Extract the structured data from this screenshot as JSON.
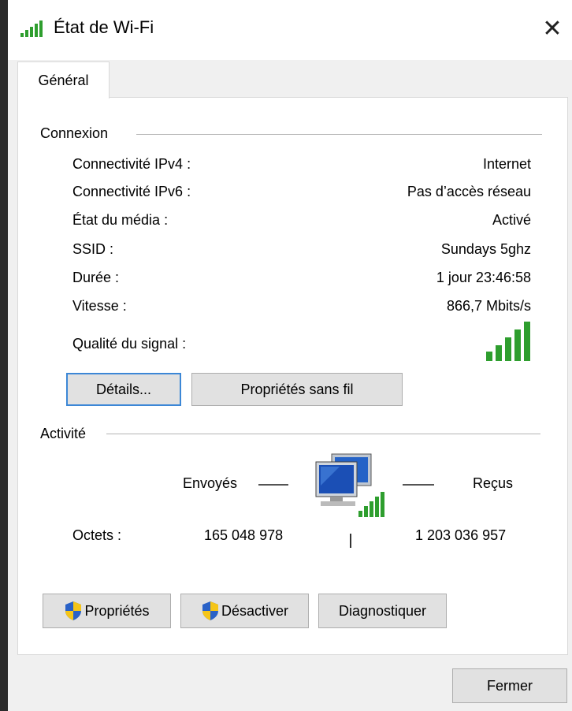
{
  "window": {
    "title": "État de Wi-Fi"
  },
  "tabs": [
    {
      "label": "Général"
    }
  ],
  "connexion": {
    "heading": "Connexion",
    "rows": [
      {
        "label": "Connectivité IPv4 :",
        "value": "Internet"
      },
      {
        "label": "Connectivité IPv6 :",
        "value": "Pas d’accès réseau"
      },
      {
        "label": "État du média :",
        "value": "Activé"
      },
      {
        "label": "SSID :",
        "value": "Sundays 5ghz"
      },
      {
        "label": "Durée :",
        "value": "1 jour 23:46:58"
      },
      {
        "label": "Vitesse :",
        "value": "866,7 Mbits/s"
      }
    ],
    "signal_label": "Qualité du signal :",
    "signal_bars": 5,
    "details_button": "Détails...",
    "wireless_props_button": "Propriétés sans fil"
  },
  "activite": {
    "heading": "Activité",
    "sent_label": "Envoyés",
    "received_label": "Reçus",
    "bytes_label": "Octets :",
    "bytes_sent": "165 048 978",
    "bytes_received": "1 203 036 957"
  },
  "buttons": {
    "properties": "Propriétés",
    "disable": "Désactiver",
    "diagnose": "Diagnostiquer",
    "close": "Fermer"
  },
  "colors": {
    "signal": "#2e9e2e",
    "focus": "#3c87d6"
  },
  "icons": {
    "title": "wifi-signal-icon",
    "close": "close-icon",
    "shield": "uac-shield-icon",
    "network": "network-computers-icon"
  }
}
